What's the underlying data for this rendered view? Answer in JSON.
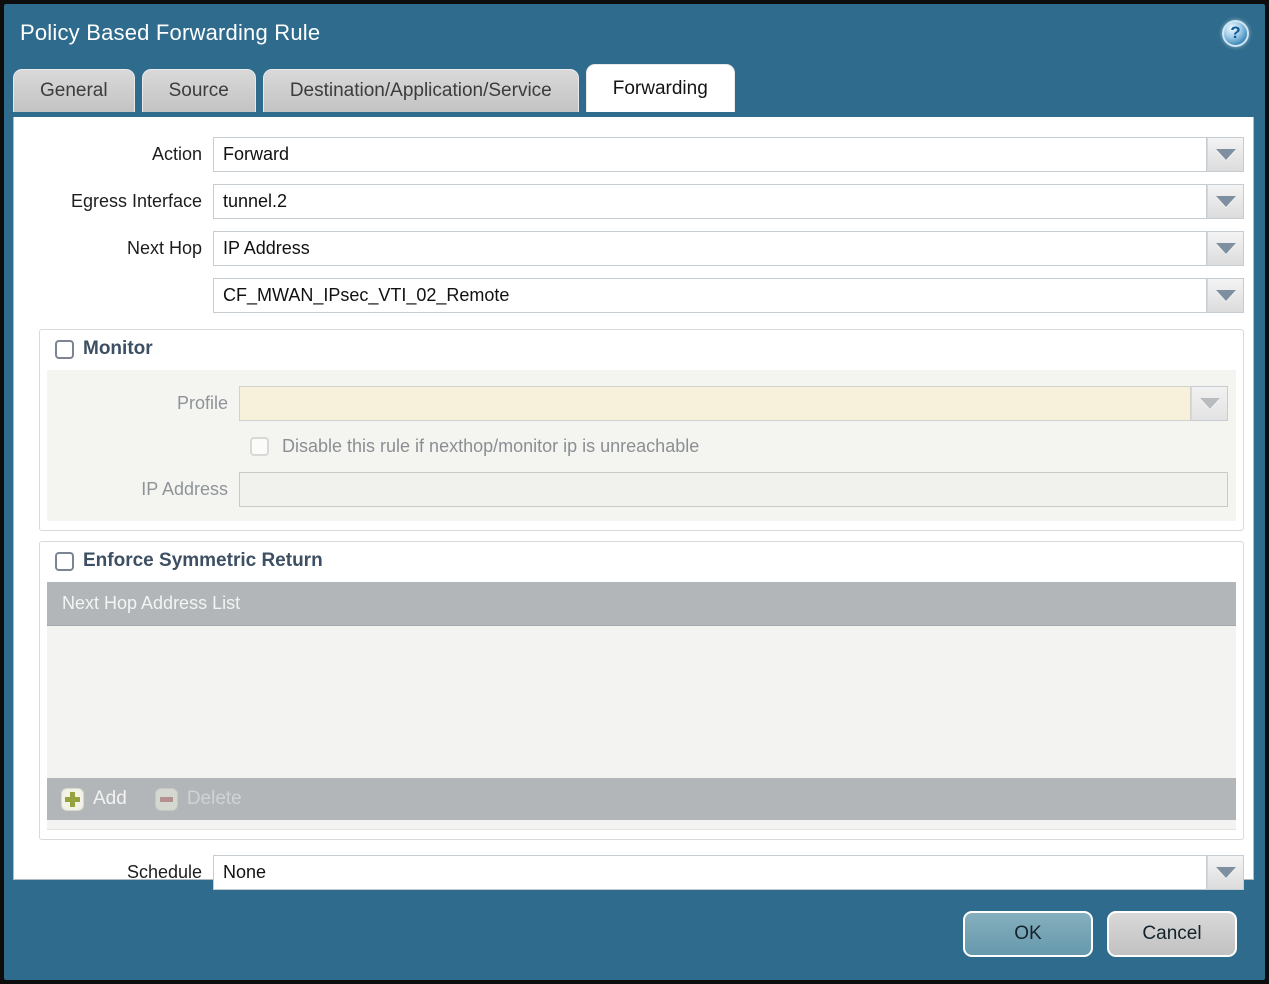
{
  "window": {
    "title": "Policy Based Forwarding Rule"
  },
  "icons": {
    "help_glyph": "?"
  },
  "tabs": [
    {
      "label": "General",
      "active": false
    },
    {
      "label": "Source",
      "active": false
    },
    {
      "label": "Destination/Application/Service",
      "active": false
    },
    {
      "label": "Forwarding",
      "active": true
    }
  ],
  "form": {
    "action": {
      "label": "Action",
      "value": "Forward"
    },
    "egress_interface": {
      "label": "Egress Interface",
      "value": "tunnel.2"
    },
    "next_hop": {
      "label": "Next Hop",
      "value": "IP Address"
    },
    "next_hop_address": {
      "value": "CF_MWAN_IPsec_VTI_02_Remote"
    },
    "schedule": {
      "label": "Schedule",
      "value": "None"
    }
  },
  "monitor": {
    "title": "Monitor",
    "checked": false,
    "profile": {
      "label": "Profile",
      "value": ""
    },
    "disable_rule": {
      "label": "Disable this rule if nexthop/monitor ip is unreachable",
      "checked": false
    },
    "ip_address": {
      "label": "IP Address",
      "value": ""
    }
  },
  "symmetric_return": {
    "title": "Enforce Symmetric Return",
    "checked": false,
    "table": {
      "header": "Next Hop Address List",
      "rows": []
    },
    "toolbar": {
      "add_label": "Add",
      "delete_label": "Delete",
      "delete_enabled": false
    }
  },
  "footer": {
    "ok_label": "OK",
    "cancel_label": "Cancel"
  },
  "colors": {
    "titlebar_background": "#2e6b8c",
    "active_tab_background": "#ffffff",
    "inactive_tab_background": "#c9c9c9",
    "disabled_field_background": "#f7f1dc",
    "grid_header_background": "#b2b6b8",
    "ok_button_background": "#6fa2b4",
    "cancel_button_background": "#cccccc"
  }
}
